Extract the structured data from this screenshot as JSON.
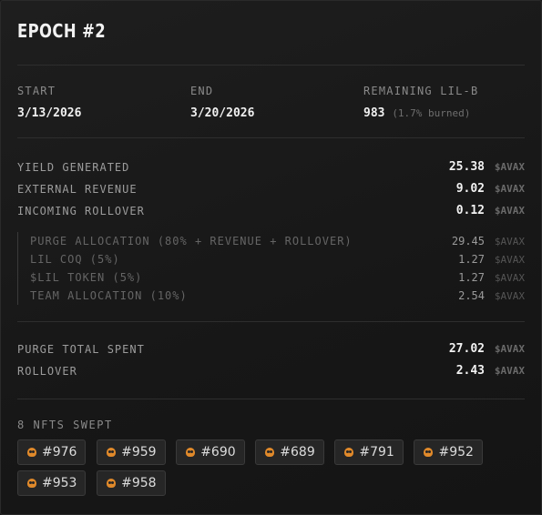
{
  "epoch": {
    "title": "EPOCH #2"
  },
  "meta": {
    "start_label": "START",
    "start_value": "3/13/2026",
    "end_label": "END",
    "end_value": "3/20/2026",
    "remaining_label": "REMAINING LIL-B",
    "remaining_value": "983",
    "remaining_note": "(1.7% burned)"
  },
  "unit": "$AVAX",
  "income": [
    {
      "label": "YIELD GENERATED",
      "value": "25.38"
    },
    {
      "label": "EXTERNAL REVENUE",
      "value": "9.02"
    },
    {
      "label": "INCOMING ROLLOVER",
      "value": "0.12"
    }
  ],
  "allocations": [
    {
      "label": "PURGE ALLOCATION (80% + REVENUE + ROLLOVER)",
      "value": "29.45"
    },
    {
      "label": "LIL COQ (5%)",
      "value": "1.27"
    },
    {
      "label": "$LIL TOKEN (5%)",
      "value": "1.27"
    },
    {
      "label": "TEAM ALLOCATION (10%)",
      "value": "2.54"
    }
  ],
  "totals": [
    {
      "label": "PURGE TOTAL SPENT",
      "value": "27.02"
    },
    {
      "label": "ROLLOVER",
      "value": "2.43"
    }
  ],
  "nfts": {
    "label": "8 NFTS SWEPT",
    "icon": "skull-icon",
    "accent": "#e0892a",
    "items": [
      "#976",
      "#959",
      "#690",
      "#689",
      "#791",
      "#952",
      "#953",
      "#958"
    ]
  }
}
